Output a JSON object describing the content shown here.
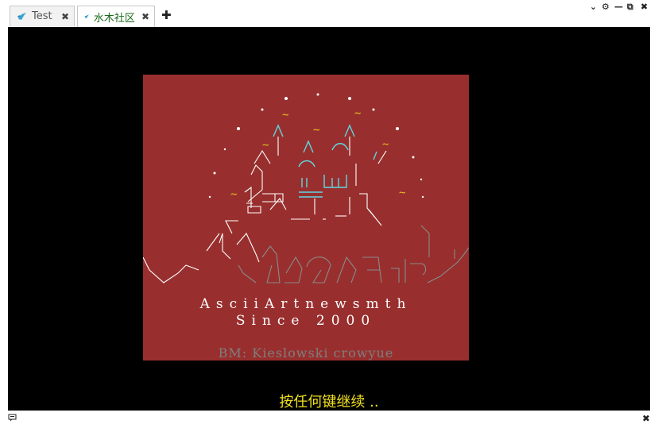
{
  "tabs": [
    {
      "label": "Test",
      "icon": "smth-logo-icon",
      "close": "✖",
      "active": false
    },
    {
      "label": "水木社区",
      "icon": "smth-logo-icon",
      "close": "✖",
      "active": true
    }
  ],
  "add_tab": "✚",
  "window_controls": {
    "dropdown": "⌄",
    "settings": "⚙",
    "minimize": "—",
    "restore": "⧉",
    "close": "✖"
  },
  "terminal": {
    "art_text": {
      "line1": "AsciiArtnewsmth",
      "line2": "Since 2000",
      "line3": "BM: Kieslowski crowyue"
    },
    "prompt": "按任何键继续 .."
  },
  "statusbar": {
    "close": "✖"
  },
  "colors": {
    "art_background": "#982f2e",
    "prompt": "#f0e020",
    "cyan": "#5fd7e0",
    "tilde": "#e8c020"
  }
}
